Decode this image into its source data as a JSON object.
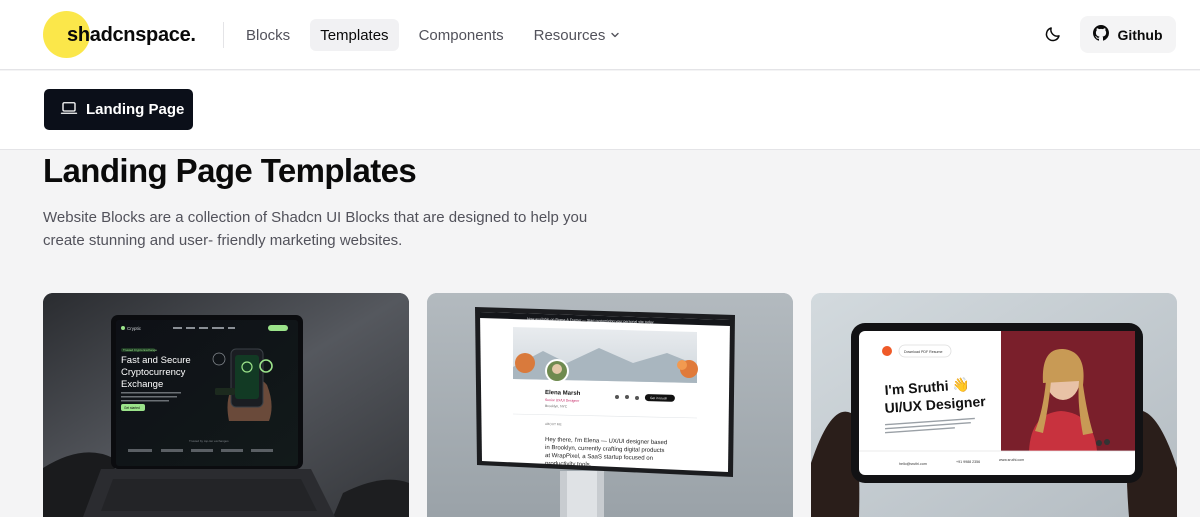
{
  "brand": {
    "name": "shadcnspace.",
    "accent_color": "#fbe74a"
  },
  "nav": {
    "items": [
      {
        "label": "Blocks",
        "active": false
      },
      {
        "label": "Templates",
        "active": true
      },
      {
        "label": "Components",
        "active": false
      },
      {
        "label": "Resources",
        "active": false,
        "has_dropdown": true
      }
    ]
  },
  "header_actions": {
    "theme_toggle_icon": "moon-icon",
    "github_label": "Github",
    "github_icon": "github-icon"
  },
  "tab": {
    "label": "Landing Page",
    "icon": "laptop-icon"
  },
  "page": {
    "title": "Landing Page Templates",
    "description": "Website Blocks are a collection of Shadcn UI Blocks that are designed to help you create stunning and user- friendly marketing websites."
  },
  "templates": [
    {
      "preview": {
        "brand": "Cryptic",
        "badge": "Trusted Crypto Exchange",
        "headline_1": "Fast and Secure",
        "headline_2": "Cryptocurrency",
        "headline_3": "Exchange",
        "cta": "Get started",
        "trusted": "Trusted by top-tier exchanges"
      }
    },
    {
      "preview": {
        "banner": "Now available on Figma & Framer — Start customizing your personal site today",
        "name": "Elena Marsh",
        "role": "Senior UX/UI Designer",
        "location": "Brooklyn, NYC",
        "cta": "Get in touch",
        "section": "ABOUT ME",
        "intro_1": "Hey there, I'm Elena — UX/UI designer based",
        "intro_2": "in Brooklyn, currently crafting digital products",
        "intro_3": "at WrapPixel, a SaaS startup focused on",
        "intro_4": "productivity tools."
      }
    },
    {
      "preview": {
        "cta": "Download PDF Resume",
        "greeting": "I'm Sruthi 👋",
        "role": "UI/UX Designer",
        "email": "hello@sruthi.com",
        "phone": "+91 9988 2356",
        "site": "www.sruthi.com"
      }
    }
  ]
}
